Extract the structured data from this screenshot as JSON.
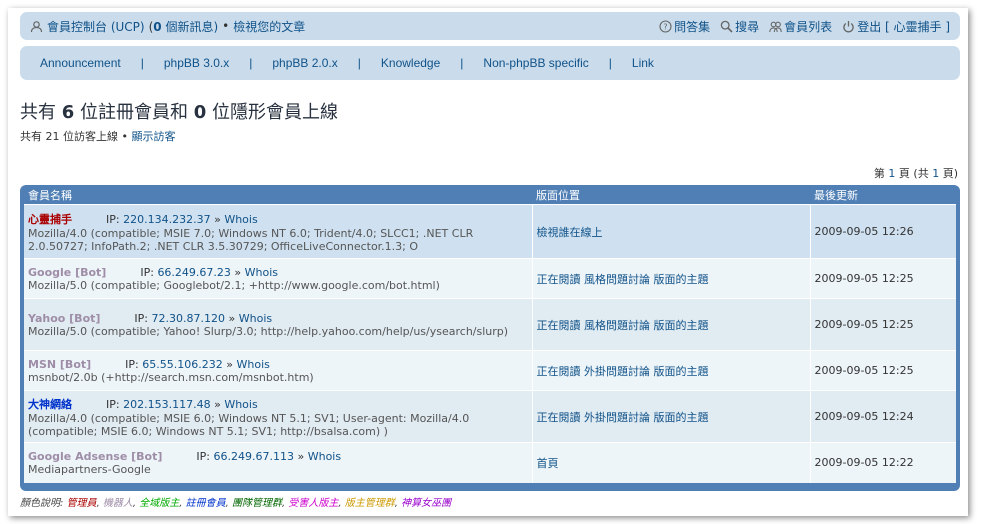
{
  "navbar": {
    "ucp_link": "會員控制台 (UCP)",
    "new_msgs_prefix": "(",
    "new_msgs_count": "0",
    "new_msgs_suffix": " 個新訊息)",
    "bullet": "•",
    "view_posts": "檢視您的文章",
    "faq": "問答集",
    "search": "搜尋",
    "memberlist": "會員列表",
    "logout": "登出 [ 心靈捕手 ]"
  },
  "menu": {
    "items": [
      "Announcement",
      "phpBB 3.0.x",
      "phpBB 2.0.x",
      "Knowledge",
      "Non-phpBB specific",
      "Link"
    ],
    "separator": "|"
  },
  "heading": {
    "prefix": "共有 ",
    "registered": "6",
    "middle": " 位註冊會員和 ",
    "hidden": "0",
    "suffix": " 位隱形會員上線"
  },
  "guests": {
    "text": "共有 21 位訪客上線",
    "bullet": "•",
    "link": "顯示訪客"
  },
  "pagination": {
    "prefix": "第 ",
    "page": "1",
    "middle": " 頁 (共 ",
    "total": "1",
    "suffix": " 頁)"
  },
  "table": {
    "headers": [
      "會員名稱",
      "版面位置",
      "最後更新"
    ],
    "rows": [
      {
        "name": "心靈捕手",
        "name_color": "#aa0000",
        "ip_label": "IP: ",
        "ip": "220.134.232.37",
        "whois_sep": " » ",
        "whois": "Whois",
        "ua": "Mozilla/4.0 (compatible; MSIE 7.0; Windows NT 6.0; Trident/4.0; SLCC1; .NET CLR 2.0.50727; InfoPath.2; .NET CLR 3.5.30729; OfficeLiveConnector.1.3; O",
        "location": "檢視誰在線上",
        "time": "2009-09-05 12:26"
      },
      {
        "name": "Google [Bot]",
        "name_color": "#9e8da7",
        "ip_label": "IP: ",
        "ip": "66.249.67.23",
        "whois_sep": " » ",
        "whois": "Whois",
        "ua": "Mozilla/5.0 (compatible; Googlebot/2.1; +http://www.google.com/bot.html)",
        "location": "正在閱讀 風格問題討論 版面的主題",
        "time": "2009-09-05 12:25"
      },
      {
        "name": "Yahoo [Bot]",
        "name_color": "#9e8da7",
        "ip_label": "IP: ",
        "ip": "72.30.87.120",
        "whois_sep": " » ",
        "whois": "Whois",
        "ua": "Mozilla/5.0 (compatible; Yahoo! Slurp/3.0; http://help.yahoo.com/help/us/ysearch/slurp)",
        "location": "正在閱讀 風格問題討論 版面的主題",
        "time": "2009-09-05 12:25"
      },
      {
        "name": "MSN [Bot]",
        "name_color": "#9e8da7",
        "ip_label": "IP: ",
        "ip": "65.55.106.232",
        "whois_sep": " » ",
        "whois": "Whois",
        "ua": "msnbot/2.0b (+http://search.msn.com/msnbot.htm)",
        "location": "正在閱讀 外掛問題討論 版面的主題",
        "time": "2009-09-05 12:25"
      },
      {
        "name": "大神網絡",
        "name_color": "#0033cc",
        "ip_label": "IP: ",
        "ip": "202.153.117.48",
        "whois_sep": " » ",
        "whois": "Whois",
        "ua": "Mozilla/4.0 (compatible; MSIE 6.0; Windows NT 5.1; SV1; User-agent: Mozilla/4.0 (compatible; MSIE 6.0; Windows NT 5.1; SV1; http://bsalsa.com) )",
        "location": "正在閱讀 外掛問題討論 版面的主題",
        "time": "2009-09-05 12:24"
      },
      {
        "name": "Google Adsense [Bot]",
        "name_color": "#9e8da7",
        "ip_label": "IP: ",
        "ip": "66.249.67.113",
        "whois_sep": " » ",
        "whois": "Whois",
        "ua": "Mediapartners-Google",
        "location": "首頁",
        "time": "2009-09-05 12:22"
      }
    ]
  },
  "legend": {
    "label": "顏色說明: ",
    "items": [
      {
        "text": "管理員",
        "color": "#aa0000"
      },
      {
        "text": "機器人",
        "color": "#9e8da7"
      },
      {
        "text": "全域版主",
        "color": "#00aa00"
      },
      {
        "text": "註冊會員",
        "color": "#0033cc"
      },
      {
        "text": "團隊管理群",
        "color": "#006600"
      },
      {
        "text": "受害人版主",
        "color": "#cc00cc"
      },
      {
        "text": "版主管理群",
        "color": "#cc9900"
      },
      {
        "text": "神算女巫團",
        "color": "#9900cc"
      }
    ],
    "sep": ", "
  }
}
